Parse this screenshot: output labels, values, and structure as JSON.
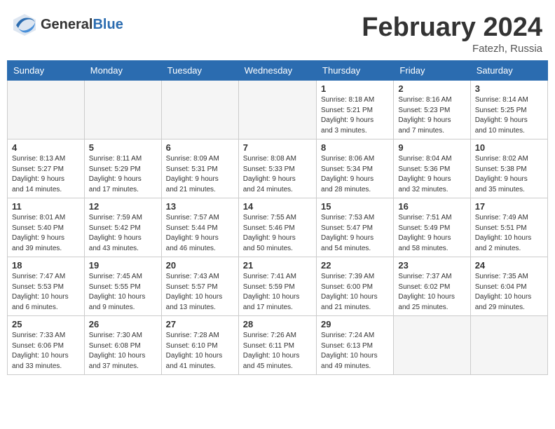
{
  "header": {
    "logo_general": "General",
    "logo_blue": "Blue",
    "month_title": "February 2024",
    "location": "Fatezh, Russia"
  },
  "weekdays": [
    "Sunday",
    "Monday",
    "Tuesday",
    "Wednesday",
    "Thursday",
    "Friday",
    "Saturday"
  ],
  "weeks": [
    [
      {
        "day": "",
        "info": ""
      },
      {
        "day": "",
        "info": ""
      },
      {
        "day": "",
        "info": ""
      },
      {
        "day": "",
        "info": ""
      },
      {
        "day": "1",
        "info": "Sunrise: 8:18 AM\nSunset: 5:21 PM\nDaylight: 9 hours\nand 3 minutes."
      },
      {
        "day": "2",
        "info": "Sunrise: 8:16 AM\nSunset: 5:23 PM\nDaylight: 9 hours\nand 7 minutes."
      },
      {
        "day": "3",
        "info": "Sunrise: 8:14 AM\nSunset: 5:25 PM\nDaylight: 9 hours\nand 10 minutes."
      }
    ],
    [
      {
        "day": "4",
        "info": "Sunrise: 8:13 AM\nSunset: 5:27 PM\nDaylight: 9 hours\nand 14 minutes."
      },
      {
        "day": "5",
        "info": "Sunrise: 8:11 AM\nSunset: 5:29 PM\nDaylight: 9 hours\nand 17 minutes."
      },
      {
        "day": "6",
        "info": "Sunrise: 8:09 AM\nSunset: 5:31 PM\nDaylight: 9 hours\nand 21 minutes."
      },
      {
        "day": "7",
        "info": "Sunrise: 8:08 AM\nSunset: 5:33 PM\nDaylight: 9 hours\nand 24 minutes."
      },
      {
        "day": "8",
        "info": "Sunrise: 8:06 AM\nSunset: 5:34 PM\nDaylight: 9 hours\nand 28 minutes."
      },
      {
        "day": "9",
        "info": "Sunrise: 8:04 AM\nSunset: 5:36 PM\nDaylight: 9 hours\nand 32 minutes."
      },
      {
        "day": "10",
        "info": "Sunrise: 8:02 AM\nSunset: 5:38 PM\nDaylight: 9 hours\nand 35 minutes."
      }
    ],
    [
      {
        "day": "11",
        "info": "Sunrise: 8:01 AM\nSunset: 5:40 PM\nDaylight: 9 hours\nand 39 minutes."
      },
      {
        "day": "12",
        "info": "Sunrise: 7:59 AM\nSunset: 5:42 PM\nDaylight: 9 hours\nand 43 minutes."
      },
      {
        "day": "13",
        "info": "Sunrise: 7:57 AM\nSunset: 5:44 PM\nDaylight: 9 hours\nand 46 minutes."
      },
      {
        "day": "14",
        "info": "Sunrise: 7:55 AM\nSunset: 5:46 PM\nDaylight: 9 hours\nand 50 minutes."
      },
      {
        "day": "15",
        "info": "Sunrise: 7:53 AM\nSunset: 5:47 PM\nDaylight: 9 hours\nand 54 minutes."
      },
      {
        "day": "16",
        "info": "Sunrise: 7:51 AM\nSunset: 5:49 PM\nDaylight: 9 hours\nand 58 minutes."
      },
      {
        "day": "17",
        "info": "Sunrise: 7:49 AM\nSunset: 5:51 PM\nDaylight: 10 hours\nand 2 minutes."
      }
    ],
    [
      {
        "day": "18",
        "info": "Sunrise: 7:47 AM\nSunset: 5:53 PM\nDaylight: 10 hours\nand 6 minutes."
      },
      {
        "day": "19",
        "info": "Sunrise: 7:45 AM\nSunset: 5:55 PM\nDaylight: 10 hours\nand 9 minutes."
      },
      {
        "day": "20",
        "info": "Sunrise: 7:43 AM\nSunset: 5:57 PM\nDaylight: 10 hours\nand 13 minutes."
      },
      {
        "day": "21",
        "info": "Sunrise: 7:41 AM\nSunset: 5:59 PM\nDaylight: 10 hours\nand 17 minutes."
      },
      {
        "day": "22",
        "info": "Sunrise: 7:39 AM\nSunset: 6:00 PM\nDaylight: 10 hours\nand 21 minutes."
      },
      {
        "day": "23",
        "info": "Sunrise: 7:37 AM\nSunset: 6:02 PM\nDaylight: 10 hours\nand 25 minutes."
      },
      {
        "day": "24",
        "info": "Sunrise: 7:35 AM\nSunset: 6:04 PM\nDaylight: 10 hours\nand 29 minutes."
      }
    ],
    [
      {
        "day": "25",
        "info": "Sunrise: 7:33 AM\nSunset: 6:06 PM\nDaylight: 10 hours\nand 33 minutes."
      },
      {
        "day": "26",
        "info": "Sunrise: 7:30 AM\nSunset: 6:08 PM\nDaylight: 10 hours\nand 37 minutes."
      },
      {
        "day": "27",
        "info": "Sunrise: 7:28 AM\nSunset: 6:10 PM\nDaylight: 10 hours\nand 41 minutes."
      },
      {
        "day": "28",
        "info": "Sunrise: 7:26 AM\nSunset: 6:11 PM\nDaylight: 10 hours\nand 45 minutes."
      },
      {
        "day": "29",
        "info": "Sunrise: 7:24 AM\nSunset: 6:13 PM\nDaylight: 10 hours\nand 49 minutes."
      },
      {
        "day": "",
        "info": ""
      },
      {
        "day": "",
        "info": ""
      }
    ]
  ]
}
